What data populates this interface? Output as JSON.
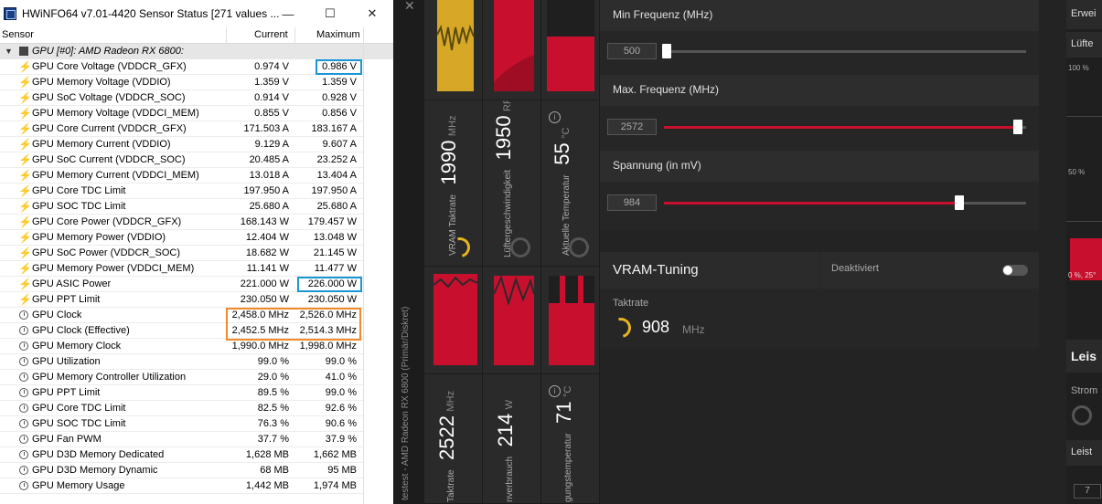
{
  "hwinfo": {
    "title": "HWiNFO64 v7.01-4420 Sensor Status [271 values ...",
    "headers": {
      "sensor": "Sensor",
      "current": "Current",
      "maximum": "Maximum"
    },
    "group_label": "GPU [#0]: AMD Radeon RX 6800:",
    "rows": [
      {
        "label": "GPU Core Voltage (VDDCR_GFX)",
        "current": "0.974 V",
        "maximum": "0.986 V",
        "icon": "bolt"
      },
      {
        "label": "GPU Memory Voltage (VDDIO)",
        "current": "1.359 V",
        "maximum": "1.359 V",
        "icon": "bolt"
      },
      {
        "label": "GPU SoC Voltage (VDDCR_SOC)",
        "current": "0.914 V",
        "maximum": "0.928 V",
        "icon": "bolt"
      },
      {
        "label": "GPU Memory Voltage (VDDCI_MEM)",
        "current": "0.855 V",
        "maximum": "0.856 V",
        "icon": "bolt"
      },
      {
        "label": "GPU Core Current (VDDCR_GFX)",
        "current": "171.503 A",
        "maximum": "183.167 A",
        "icon": "bolt"
      },
      {
        "label": "GPU Memory Current (VDDIO)",
        "current": "9.129 A",
        "maximum": "9.607 A",
        "icon": "bolt"
      },
      {
        "label": "GPU SoC Current (VDDCR_SOC)",
        "current": "20.485 A",
        "maximum": "23.252 A",
        "icon": "bolt"
      },
      {
        "label": "GPU Memory Current (VDDCI_MEM)",
        "current": "13.018 A",
        "maximum": "13.404 A",
        "icon": "bolt"
      },
      {
        "label": "GPU Core TDC Limit",
        "current": "197.950 A",
        "maximum": "197.950 A",
        "icon": "bolt"
      },
      {
        "label": "GPU SOC TDC Limit",
        "current": "25.680 A",
        "maximum": "25.680 A",
        "icon": "bolt"
      },
      {
        "label": "GPU Core Power (VDDCR_GFX)",
        "current": "168.143 W",
        "maximum": "179.457 W",
        "icon": "bolt"
      },
      {
        "label": "GPU Memory Power (VDDIO)",
        "current": "12.404 W",
        "maximum": "13.048 W",
        "icon": "bolt"
      },
      {
        "label": "GPU SoC Power (VDDCR_SOC)",
        "current": "18.682 W",
        "maximum": "21.145 W",
        "icon": "bolt"
      },
      {
        "label": "GPU Memory Power (VDDCI_MEM)",
        "current": "11.141 W",
        "maximum": "11.477 W",
        "icon": "bolt"
      },
      {
        "label": "GPU ASIC Power",
        "current": "221.000 W",
        "maximum": "226.000 W",
        "icon": "bolt"
      },
      {
        "label": "GPU PPT Limit",
        "current": "230.050 W",
        "maximum": "230.050 W",
        "icon": "bolt"
      },
      {
        "label": "GPU Clock",
        "current": "2,458.0 MHz",
        "maximum": "2,526.0 MHz",
        "icon": "clock"
      },
      {
        "label": "GPU Clock (Effective)",
        "current": "2,452.5 MHz",
        "maximum": "2,514.3 MHz",
        "icon": "clock"
      },
      {
        "label": "GPU Memory Clock",
        "current": "1,990.0 MHz",
        "maximum": "1,998.0 MHz",
        "icon": "clock"
      },
      {
        "label": "GPU Utilization",
        "current": "99.0 %",
        "maximum": "99.0 %",
        "icon": "clock"
      },
      {
        "label": "GPU Memory Controller Utilization",
        "current": "29.0 %",
        "maximum": "41.0 %",
        "icon": "clock"
      },
      {
        "label": "GPU PPT Limit",
        "current": "89.5 %",
        "maximum": "99.0 %",
        "icon": "clock"
      },
      {
        "label": "GPU Core TDC Limit",
        "current": "82.5 %",
        "maximum": "92.6 %",
        "icon": "clock"
      },
      {
        "label": "GPU SOC TDC Limit",
        "current": "76.3 %",
        "maximum": "90.6 %",
        "icon": "clock"
      },
      {
        "label": "GPU Fan PWM",
        "current": "37.7 %",
        "maximum": "37.9 %",
        "icon": "clock"
      },
      {
        "label": "GPU D3D Memory Dedicated",
        "current": "1,628 MB",
        "maximum": "1,662 MB",
        "icon": "clock"
      },
      {
        "label": "GPU D3D Memory Dynamic",
        "current": "68 MB",
        "maximum": "95 MB",
        "icon": "clock"
      },
      {
        "label": "GPU Memory Usage",
        "current": "1,442 MB",
        "maximum": "1,974 MB",
        "icon": "clock"
      }
    ]
  },
  "amd": {
    "close_glyph": "✕",
    "vertical_title": "testest - AMD Radeon RX 6800 (Primär/Diskret)",
    "tiles": {
      "vram_clock": {
        "name": "VRAM Taktrate",
        "value": "1990",
        "unit": "MHz"
      },
      "fan_speed": {
        "name": "Lüftergeschwindigkeit",
        "value": "1950",
        "unit": "RPM"
      },
      "temperature": {
        "name": "Aktuelle Temperatur",
        "value": "55",
        "unit": "°C"
      },
      "clock": {
        "name": "Taktrate",
        "value": "2522",
        "unit": "MHz"
      },
      "power": {
        "name": "nverbrauch",
        "value": "214",
        "unit": "W"
      },
      "junction_temp": {
        "name": "gungstemperatur",
        "value": "71",
        "unit": "°C"
      }
    },
    "tuning": {
      "min_freq_label": "Min Frequenz (MHz)",
      "min_freq_value": "500",
      "max_freq_label": "Max. Frequenz (MHz)",
      "max_freq_value": "2572",
      "voltage_label": "Spannung (in mV)",
      "voltage_value": "984"
    },
    "vram_tuning": {
      "title": "VRAM-Tuning",
      "state": "Deaktiviert",
      "clock_label": "Taktrate",
      "clock_value": "908",
      "clock_unit": "MHz"
    },
    "right": {
      "erwei": "Erwei",
      "lufte": "Lüfte",
      "pct100": "100 %",
      "pct50": "50 %",
      "axis": "0 %, 25°",
      "leis": "Leis",
      "strom": "Strom",
      "leist": "Leist",
      "seven": "7"
    }
  },
  "colors": {
    "amd_red": "#c8102e",
    "amd_yellow": "#e7b321",
    "highlight_blue": "#1a96d6",
    "highlight_orange": "#f08a2a"
  }
}
